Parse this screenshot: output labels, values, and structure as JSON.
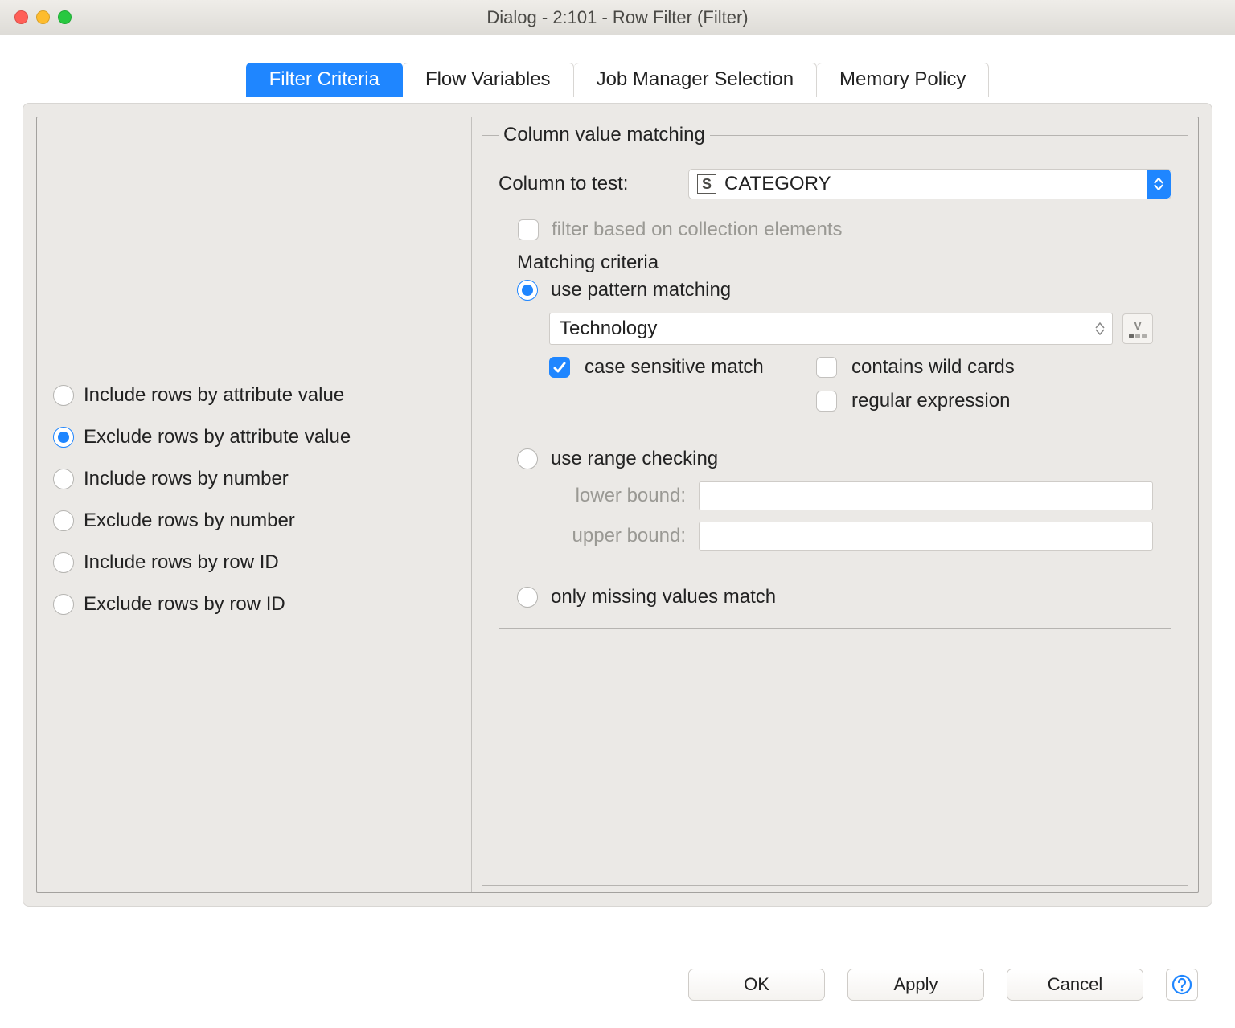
{
  "window": {
    "title": "Dialog - 2:101 - Row Filter (Filter)"
  },
  "traffic_colors": {
    "close": "#ff5f57",
    "min": "#febc2e",
    "max": "#28c840"
  },
  "tabs": [
    {
      "label": "Filter Criteria",
      "active": true
    },
    {
      "label": "Flow Variables",
      "active": false
    },
    {
      "label": "Job Manager Selection",
      "active": false
    },
    {
      "label": "Memory Policy",
      "active": false
    }
  ],
  "left_options": [
    {
      "label": "Include rows by attribute value",
      "selected": false
    },
    {
      "label": "Exclude rows by attribute value",
      "selected": true
    },
    {
      "label": "Include rows by number",
      "selected": false
    },
    {
      "label": "Exclude rows by number",
      "selected": false
    },
    {
      "label": "Include rows by row ID",
      "selected": false
    },
    {
      "label": "Exclude rows by row ID",
      "selected": false
    }
  ],
  "right": {
    "group_title": "Column value matching",
    "column_to_test_label": "Column to test:",
    "column_selected": "CATEGORY",
    "column_type_badge": "S",
    "filter_collection_label": "filter based on collection elements",
    "filter_collection_checked": false,
    "matching_group_title": "Matching criteria",
    "pattern_radio_label": "use pattern matching",
    "pattern_radio_selected": true,
    "pattern_value": "Technology",
    "case_sensitive_label": "case sensitive match",
    "case_sensitive_checked": true,
    "wildcards_label": "contains wild cards",
    "wildcards_checked": false,
    "regex_label": "regular expression",
    "regex_checked": false,
    "range_radio_label": "use range checking",
    "range_radio_selected": false,
    "lower_bound_label": "lower bound:",
    "lower_bound_value": "",
    "upper_bound_label": "upper bound:",
    "upper_bound_value": "",
    "missing_radio_label": "only missing values match",
    "missing_radio_selected": false
  },
  "buttons": {
    "ok": "OK",
    "apply": "Apply",
    "cancel": "Cancel"
  }
}
